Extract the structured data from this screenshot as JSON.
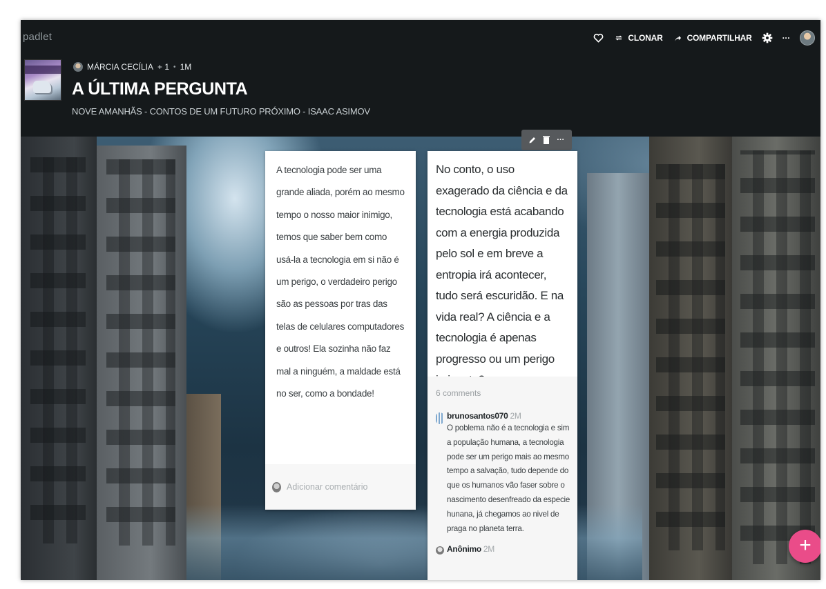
{
  "header": {
    "brand": "padlet",
    "toolbar": {
      "clone_label": "CLONAR",
      "share_label": "COMPARTILHAR",
      "more_label": "···"
    },
    "meta": {
      "author": "MÁRCIA CECÍLIA",
      "plus_count": "+ 1",
      "separator": "•",
      "age": "1M"
    },
    "title": "A ÚLTIMA PERGUNTA",
    "subtitle": "NOVE AMANHÃS - CONTOS DE UM FUTURO PRÓXIMO - ISAAC ASIMOV"
  },
  "posts": [
    {
      "text": "A tecnologia pode ser uma grande aliada, porém ao mesmo tempo o nosso maior inimigo, temos que saber bem como usá-la a tecnologia em si não é um perigo, o verdadeiro perigo são as pessoas por tras das telas de celulares computadores e outros! Ela sozinha não faz mal a ninguém, a maldade está no ser, como a bondade!",
      "add_comment_placeholder": "Adicionar comentário"
    },
    {
      "text": "No conto, o uso exagerado da ciência e da tecnologia está acabando com  a energia produzida pelo sol  e em breve a entropia irá acontecer, tudo será escuridão. E na vida real? A ciência e a tecnologia é apenas progresso ou um perigo iminente?",
      "comments_count": "6 comments",
      "comments": [
        {
          "author": "brunosantos070",
          "time": "2M",
          "text": "O poblema não é a tecnologia e sim a população humana, a tecnologia pode ser um perigo mais ao mesmo tempo a salvação, tudo depende do que os humanos vão faser sobre o nascimento desenfreado da especie hunana, já chegamos ao nivel de praga no planeta terra."
        },
        {
          "author": "Anônimo",
          "time": "2M",
          "text": ""
        }
      ],
      "actions": {
        "more_label": "···"
      }
    }
  ],
  "fab": {
    "label": "+"
  },
  "colors": {
    "header_bg": "#15191b",
    "fab": "#ea4c89",
    "card_bg": "#ffffff",
    "comments_bg": "#f6f6f6"
  },
  "icons": [
    "heart-icon",
    "clone-icon",
    "share-icon",
    "gear-icon",
    "more-icon",
    "avatar",
    "pencil-icon",
    "trash-icon",
    "plus-icon"
  ]
}
